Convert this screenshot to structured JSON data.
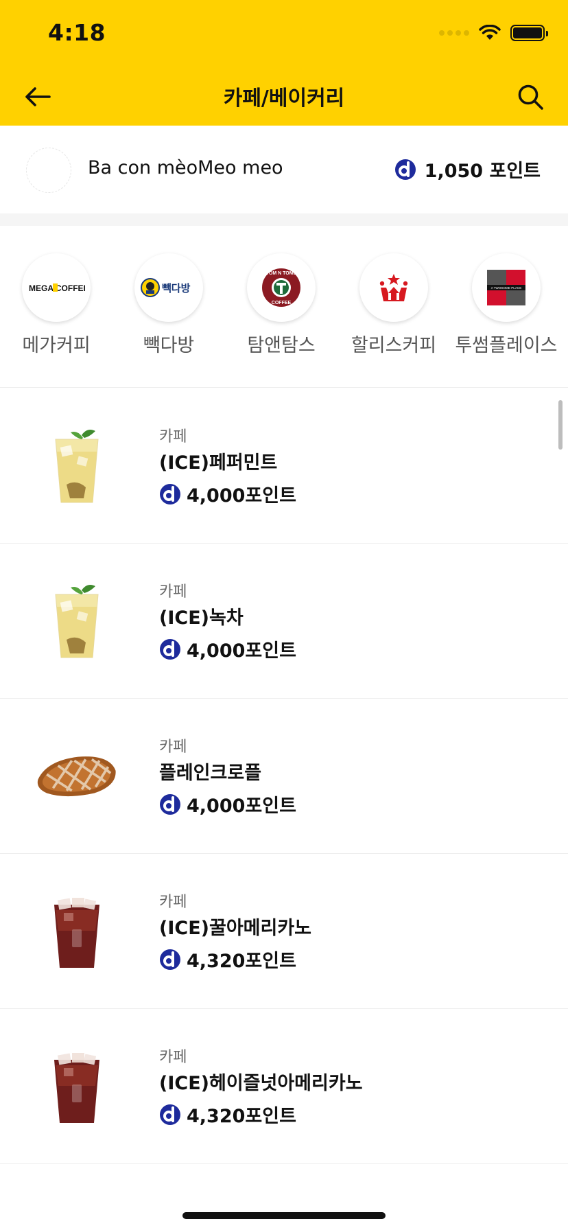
{
  "status_bar": {
    "time": "4:18"
  },
  "header": {
    "title": "카페/베이커리"
  },
  "user": {
    "name": "Ba con mèoMeo meo",
    "points": "1,050 포인트"
  },
  "brands": [
    {
      "label": "메가커피",
      "logo_text": "MEGA COFFEE"
    },
    {
      "label": "빽다방",
      "logo_text": "빽다방"
    },
    {
      "label": "탐앤탐스",
      "logo_text": "TOM N TOMS COFFEE"
    },
    {
      "label": "할리스커피",
      "logo_text": ""
    },
    {
      "label": "투썸플레이스",
      "logo_text": "A TWOSOME PLACE"
    }
  ],
  "products": [
    {
      "category": "카페",
      "name": "(ICE)페퍼민트",
      "price": "4,000포인트",
      "image": "iced-tea"
    },
    {
      "category": "카페",
      "name": "(ICE)녹차",
      "price": "4,000포인트",
      "image": "iced-tea"
    },
    {
      "category": "카페",
      "name": "플레인크로플",
      "price": "4,000포인트",
      "image": "croffle"
    },
    {
      "category": "카페",
      "name": "(ICE)꿀아메리카노",
      "price": "4,320포인트",
      "image": "iced-americano"
    },
    {
      "category": "카페",
      "name": "(ICE)헤이즐넛아메리카노",
      "price": "4,320포인트",
      "image": "iced-americano"
    }
  ],
  "colors": {
    "header_bg": "#FFD100",
    "point_icon": "#1E2B9C",
    "hollys_red": "#D71920",
    "twosome_red": "#D2102D"
  }
}
